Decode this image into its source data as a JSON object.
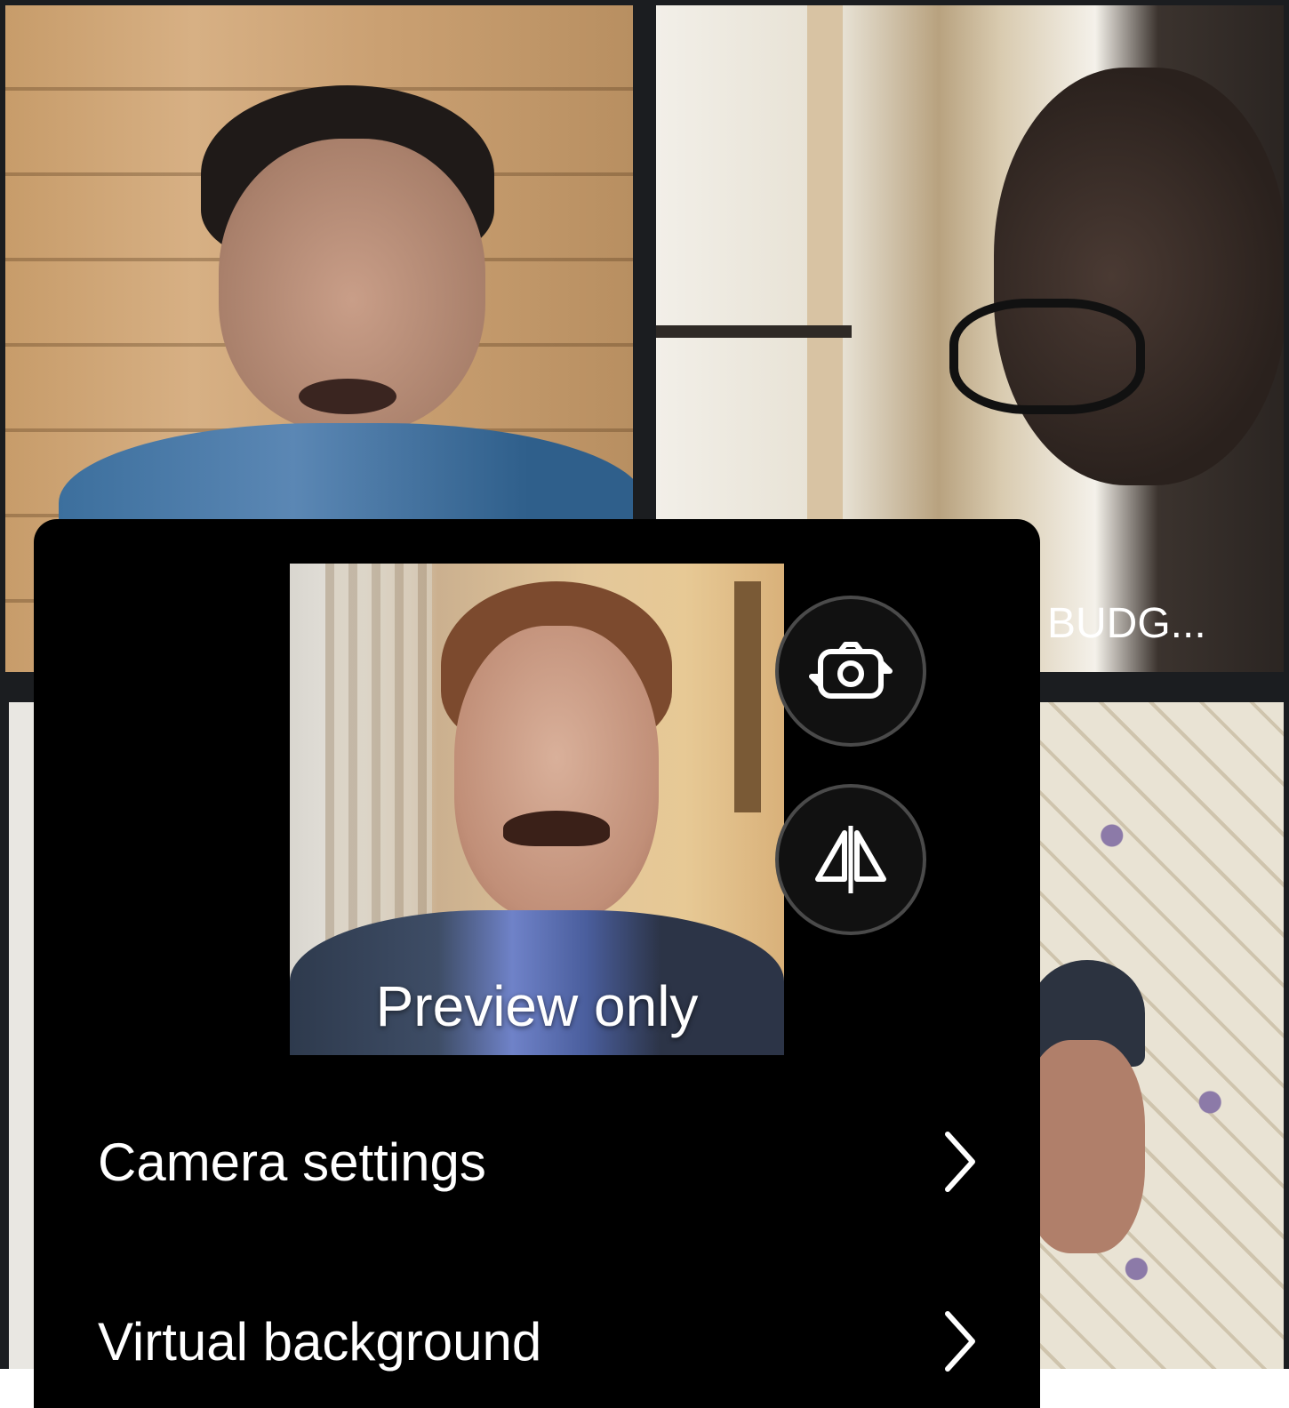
{
  "participants": [
    {
      "name": "",
      "active": true
    },
    {
      "name": "BUDG...",
      "active": false
    },
    {
      "name": "",
      "active": false
    }
  ],
  "camera_sheet": {
    "preview_label": "Preview only",
    "buttons": [
      {
        "icon": "camera-flip-icon"
      },
      {
        "icon": "mirror-icon"
      }
    ],
    "menu": [
      {
        "label": "Camera settings",
        "icon": "chevron-right-icon"
      },
      {
        "label": "Virtual background",
        "icon": "chevron-right-icon"
      }
    ]
  },
  "colors": {
    "active_speaker_border": "#8fd6e6",
    "sheet_background": "#000000",
    "text": "#ffffff"
  }
}
